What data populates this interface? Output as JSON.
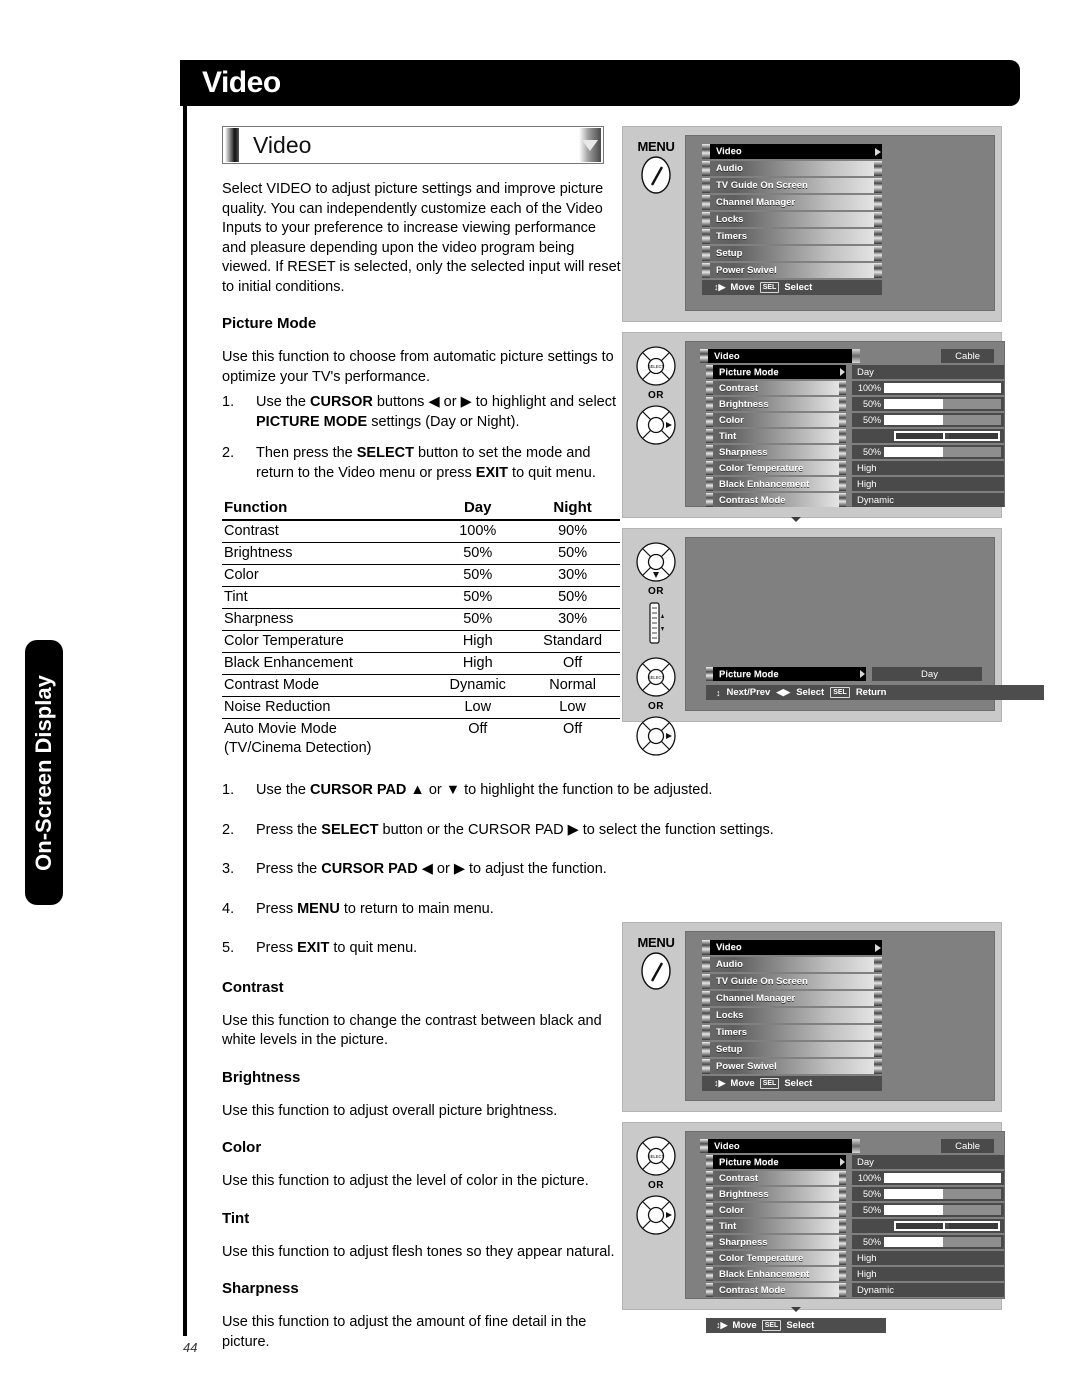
{
  "page": {
    "banner_title": "Video",
    "side_tab": "On-Screen Display",
    "page_number": "44"
  },
  "title_bar": {
    "label": "Video",
    "dropdown_icon": "triangle-down-icon"
  },
  "intro": "Select VIDEO to adjust picture settings and improve picture quality. You can independently customize each of the Video Inputs to your preference to increase viewing performance and pleasure depending upon the video program being viewed. If RESET is selected, only the selected input will reset to initial conditions.",
  "picture_mode": {
    "heading": "Picture Mode",
    "desc": "Use this function to choose from automatic picture settings to optimize your TV's performance.",
    "steps": [
      {
        "num": "1.",
        "html": "Use the <b>CURSOR</b> buttons ◀ or ▶ to highlight and select <b>PICTURE MODE</b> settings (Day or Night)."
      },
      {
        "num": "2.",
        "html": "Then press the <b>SELECT</b> button to set the mode and return to the Video menu or press <b>EXIT</b> to quit menu."
      }
    ]
  },
  "table": {
    "headers": [
      "Function",
      "Day",
      "Night"
    ],
    "rows": [
      [
        "Contrast",
        "100%",
        "90%"
      ],
      [
        "Brightness",
        "50%",
        "50%"
      ],
      [
        "Color",
        "50%",
        "30%"
      ],
      [
        "Tint",
        "50%",
        "50%"
      ],
      [
        "Sharpness",
        "50%",
        "30%"
      ],
      [
        "Color Temperature",
        "High",
        "Standard"
      ],
      [
        "Black Enhancement",
        "High",
        "Off"
      ],
      [
        "Contrast Mode",
        "Dynamic",
        "Normal"
      ],
      [
        "Noise Reduction",
        "Low",
        "Low"
      ],
      [
        "Auto Movie Mode",
        "Off",
        "Off"
      ]
    ],
    "continuation_row": "(TV/Cinema Detection)"
  },
  "adjust_steps": [
    {
      "num": "1.",
      "html": "Use the <b>CURSOR PAD</b> ▲ or ▼ to highlight the function to be adjusted."
    },
    {
      "num": "2.",
      "html": "Press the <b>SELECT</b> button or the CURSOR PAD ▶ to select the function settings."
    },
    {
      "num": "3.",
      "html": "Press the <b>CURSOR PAD</b> ◀ or ▶ to adjust the function."
    },
    {
      "num": "4.",
      "html": "Press <b>MENU</b> to return to main menu."
    },
    {
      "num": "5.",
      "html": "Press <b>EXIT</b> to quit menu."
    }
  ],
  "definitions": [
    {
      "heading": "Contrast",
      "text": "Use this function to change the contrast between black and white levels in the picture."
    },
    {
      "heading": "Brightness",
      "text": "Use this function to adjust overall picture brightness."
    },
    {
      "heading": "Color",
      "text": "Use this function to adjust the level of color in the picture."
    },
    {
      "heading": "Tint",
      "text": "Use this function to adjust flesh tones so they appear natural."
    },
    {
      "heading": "Sharpness",
      "text": "Use this function to adjust the amount of fine detail in the picture."
    }
  ],
  "osd": {
    "menu_word": "MENU",
    "or_label": "OR",
    "main_menu_items": [
      "Video",
      "Audio",
      "TV Guide On Screen",
      "Channel Manager",
      "Locks",
      "Timers",
      "Setup",
      "Power Swivel"
    ],
    "main_menu_selected": "Video",
    "footer_move": "Move",
    "footer_select": "Select",
    "sel_key": "SEL",
    "video_header": "Video",
    "input_badge": "Cable",
    "settings": [
      {
        "label": "Picture Mode",
        "value": "Day",
        "type": "text",
        "selected": true
      },
      {
        "label": "Contrast",
        "value": "100%",
        "type": "gauge",
        "fill": 100
      },
      {
        "label": "Brightness",
        "value": "50%",
        "type": "gauge",
        "fill": 50
      },
      {
        "label": "Color",
        "value": "50%",
        "type": "gauge",
        "fill": 50
      },
      {
        "label": "Tint",
        "value": "",
        "type": "tint",
        "fill": 50
      },
      {
        "label": "Sharpness",
        "value": "50%",
        "type": "gauge",
        "fill": 50
      },
      {
        "label": "Color Temperature",
        "value": "High",
        "type": "text"
      },
      {
        "label": "Black Enhancement",
        "value": "High",
        "type": "text"
      },
      {
        "label": "Contrast Mode",
        "value": "Dynamic",
        "type": "text"
      }
    ],
    "picture_mode_row": {
      "label": "Picture Mode",
      "value": "Day"
    },
    "footer_nextprev": "Next/Prev",
    "footer_select2": "Select",
    "footer_return": "Return"
  }
}
